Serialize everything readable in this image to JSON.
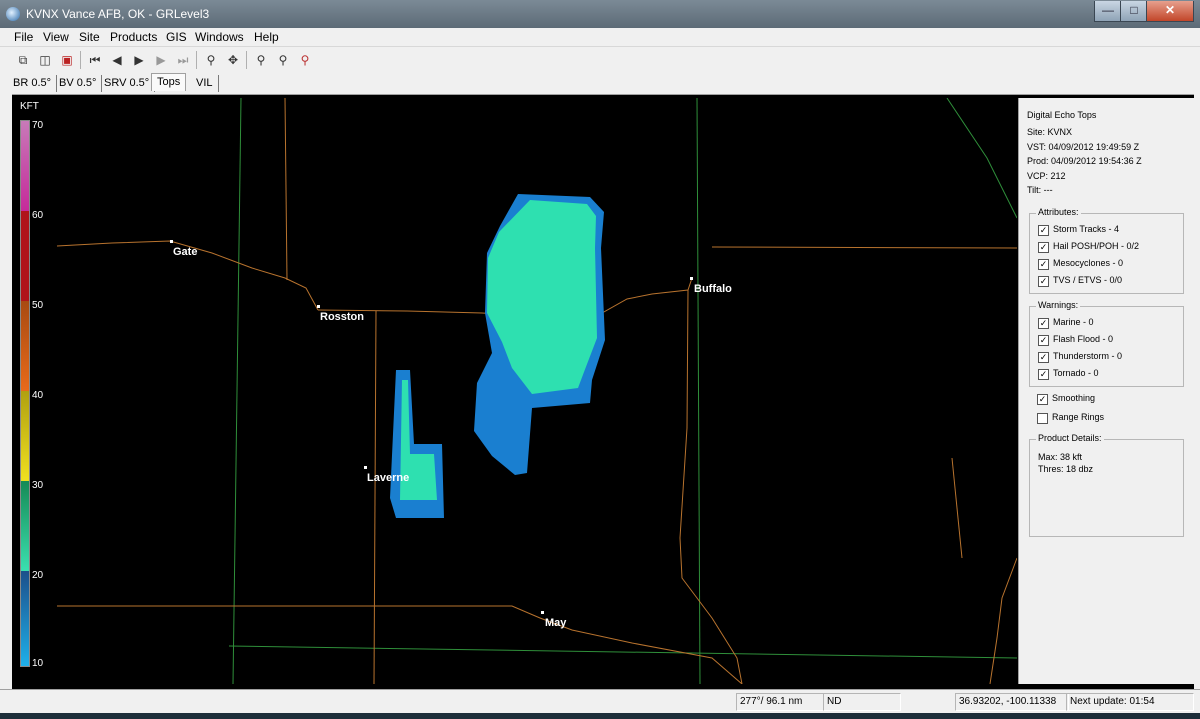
{
  "window": {
    "title": "KVNX Vance AFB, OK - GRLevel3"
  },
  "menu": [
    "File",
    "View",
    "Site",
    "Products",
    "GIS",
    "Windows",
    "Help"
  ],
  "tabs": [
    {
      "label": "BR 0.5°",
      "active": false
    },
    {
      "label": "BV 0.5°",
      "active": false
    },
    {
      "label": "SRV 0.5°",
      "active": false
    },
    {
      "label": "Tops",
      "active": true
    },
    {
      "label": "VIL",
      "active": false
    }
  ],
  "map": {
    "legend_unit": "KFT",
    "legend_ticks": [
      "70",
      "60",
      "50",
      "40",
      "30",
      "20",
      "10"
    ],
    "cities": [
      "Gate",
      "Rosston",
      "Buffalo",
      "Laverne",
      "May"
    ]
  },
  "panel": {
    "product_name": "Digital Echo Tops",
    "site_line": "Site:  KVNX",
    "vst_line": "VST:  04/09/2012  19:49:59 Z",
    "prod_line": "Prod: 04/09/2012  19:54:36 Z",
    "vcp_line": "VCP:  212",
    "tilt_line": "Tilt:  ---",
    "attributes_title": "Attributes:",
    "attributes": [
      {
        "label": "Storm Tracks - 4",
        "checked": true
      },
      {
        "label": "Hail POSH/POH - 0/2",
        "checked": true
      },
      {
        "label": "Mesocyclones - 0",
        "checked": true
      },
      {
        "label": "TVS / ETVS - 0/0",
        "checked": true
      }
    ],
    "warnings_title": "Warnings:",
    "warnings": [
      {
        "label": "Marine - 0",
        "checked": true
      },
      {
        "label": "Flash Flood - 0",
        "checked": true
      },
      {
        "label": "Thunderstorm - 0",
        "checked": true
      },
      {
        "label": "Tornado - 0",
        "checked": true
      }
    ],
    "smoothing": {
      "label": "Smoothing",
      "checked": true
    },
    "range_rings": {
      "label": "Range Rings",
      "checked": false
    },
    "details_title": "Product Details:",
    "details_max": "Max:     38 kft",
    "details_thres": "Thres:   18 dbz"
  },
  "status": {
    "azimuth_range": "277°/ 96.1 nm",
    "value": "ND",
    "coords": "36.93202, -100.11338",
    "next_update": "Next update: 01:54"
  },
  "colors": {
    "echo_top_20kft": "#2ee0b0",
    "echo_top_15kft": "#1a7fd0",
    "roads": "#b8732e",
    "county_lines": "#2f8f3a"
  }
}
